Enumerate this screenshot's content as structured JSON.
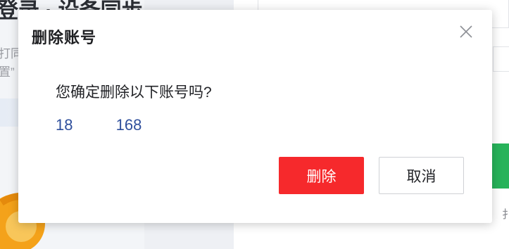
{
  "background": {
    "heading": "登录 · 设备同步",
    "lines": [
      "打同",
      "置”"
    ],
    "side_text": "扌"
  },
  "dialog": {
    "title": "删除账号",
    "message": "您确定删除以下账号吗?",
    "account": "18          168",
    "delete_label": "删除",
    "cancel_label": "取消",
    "close_icon": "close-icon"
  },
  "colors": {
    "delete_button": "#f6292c",
    "account_text": "#2f4f9c",
    "accent_green": "#27b35a"
  }
}
